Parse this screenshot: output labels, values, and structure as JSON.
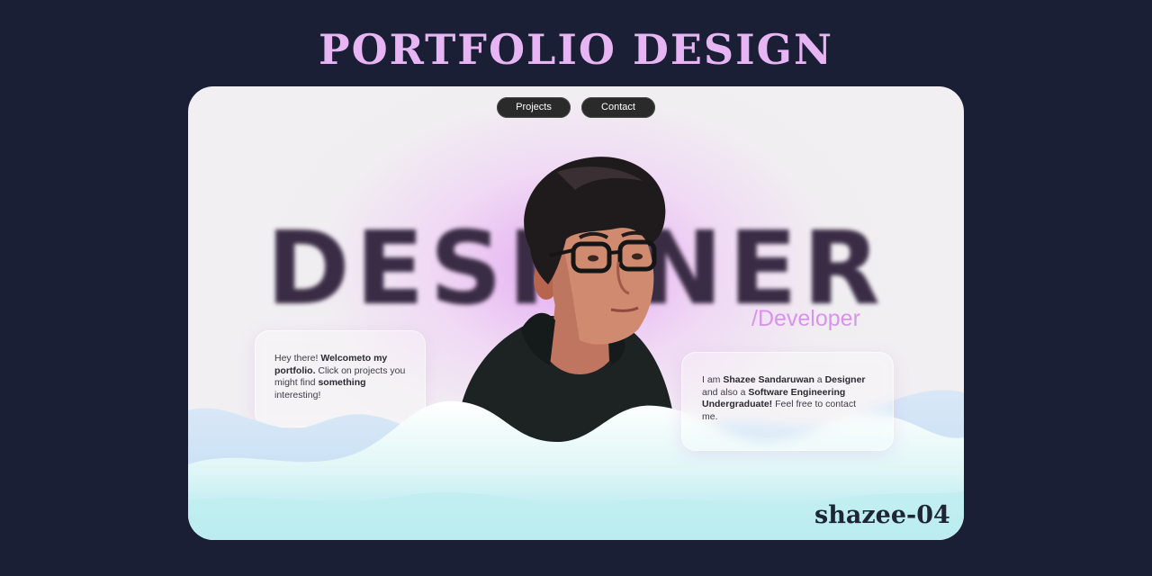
{
  "header": {
    "title": "PORTFOLIO DESIGN"
  },
  "nav": {
    "projects": "Projects",
    "contact": "Contact"
  },
  "hero": {
    "big_word": "DESIGNER",
    "role": "/Developer"
  },
  "intro_card": {
    "t1": "Hey there! ",
    "b1": "Welcometo my portfolio.",
    "t2": " Click on projects you might find ",
    "b2": "something",
    "t3": " interesting!"
  },
  "about_card": {
    "t1": "I am ",
    "b1": "Shazee Sandaruwan",
    "t2": " a ",
    "b2": "Designer",
    "t3": " and also a ",
    "b3": "Software Engineering Undergraduate!",
    "t4": " Feel free to contact me."
  },
  "footer": {
    "brand": "shazee-04"
  },
  "colors": {
    "background": "#1b1f35",
    "title": "#e7b5f3",
    "accent_role": "#d993ef",
    "button_bg": "#2a2a2a",
    "cloud_teal": "#d4f7f2"
  },
  "icons": {
    "avatar": "illustrated-portrait"
  }
}
